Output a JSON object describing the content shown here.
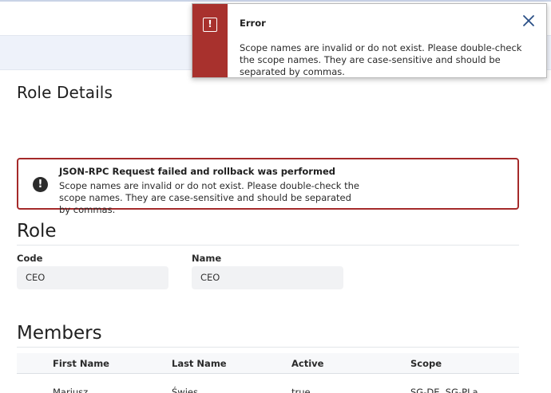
{
  "page": {
    "title": "Role Details"
  },
  "alert": {
    "title": "JSON-RPC Request failed and rollback was performed",
    "message": "Scope names are invalid or do not exist. Please double-check the scope names. They are case-sensitive and should be separated by commas.",
    "icon": "exclamation-circle-icon"
  },
  "role": {
    "heading": "Role",
    "code_label": "Code",
    "code_value": "CEO",
    "name_label": "Name",
    "name_value": "CEO"
  },
  "members": {
    "heading": "Members",
    "columns": [
      "First Name",
      "Last Name",
      "Active",
      "Scope"
    ],
    "rows": [
      [
        "Mariusz",
        "Świes",
        "true",
        "SG-DE, SG-PLa"
      ]
    ]
  },
  "toast": {
    "title": "Error",
    "message": "Scope names are invalid or do not exist. Please double-check the scope names. They are case-sensitive and should be separated by commas.",
    "icon": "alert-icon",
    "close_icon": "close-icon"
  },
  "colors": {
    "error_red": "#a8312d",
    "alert_border": "#a52a2a",
    "header_band": "#eef2fa"
  }
}
